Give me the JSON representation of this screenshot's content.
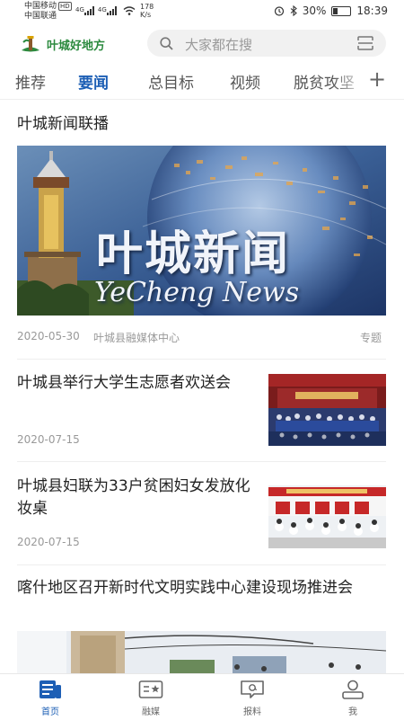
{
  "status_bar": {
    "carrier1": "中国移动",
    "carrier1_badge": "HD",
    "carrier2": "中国联通",
    "signal1": "4G",
    "signal2": "4G",
    "speed_value": "178",
    "speed_unit": "K/s",
    "battery": "30%",
    "time": "18:39"
  },
  "header": {
    "app_name": "叶城好地方",
    "search_placeholder": "大家都在搜"
  },
  "tabs": [
    "推荐",
    "要闻",
    "总目标",
    "视频",
    "脱贫攻坚"
  ],
  "active_tab": "要闻",
  "feed": {
    "hero": {
      "title": "叶城新闻联播",
      "image_title_cn": "叶城新闻",
      "image_title_en": "YeCheng News",
      "date": "2020-05-30",
      "source": "叶城县融媒体中心",
      "tag": "专题"
    },
    "items": [
      {
        "title": "叶城县举行大学生志愿者欢送会",
        "date": "2020-07-15"
      },
      {
        "title": "叶城县妇联为33户贫困妇女发放化妆桌",
        "date": "2020-07-15"
      },
      {
        "title": "喀什地区召开新时代文明实践中心建设现场推进会"
      }
    ]
  },
  "bottom_nav": [
    "首页",
    "融媒",
    "报料",
    "我"
  ],
  "colors": {
    "accent": "#1d5fb5",
    "brand_green": "#2b8a3e"
  }
}
